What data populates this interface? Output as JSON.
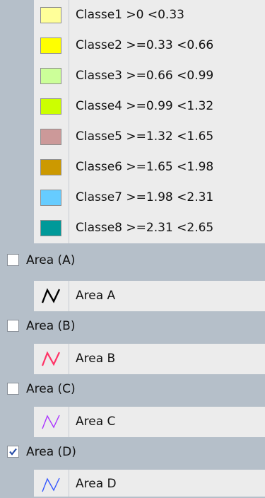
{
  "legend": {
    "classes": [
      {
        "label": "Classe1 >0 <0.33",
        "color": "#ffff99"
      },
      {
        "label": "Classe2 >=0.33 <0.66",
        "color": "#ffff00"
      },
      {
        "label": "Classe3 >=0.66 <0.99",
        "color": "#ccff99"
      },
      {
        "label": "Classe4 >=0.99 <1.32",
        "color": "#ccff00"
      },
      {
        "label": "Classe5 >=1.32 <1.65",
        "color": "#cc9999"
      },
      {
        "label": "Classe6 >=1.65 <1.98",
        "color": "#cc9900"
      },
      {
        "label": "Classe7 >=1.98 <2.31",
        "color": "#66ccff"
      },
      {
        "label": "Classe8 >=2.31 <2.65",
        "color": "#009999"
      }
    ],
    "layers": [
      {
        "title": "Area (A)",
        "checked": false,
        "symbol_label": "Area A",
        "symbol_icon": "line-symbol-icon",
        "symbol_color": "#000000"
      },
      {
        "title": "Area (B)",
        "checked": false,
        "symbol_label": "Area B",
        "symbol_icon": "line-symbol-icon",
        "symbol_color": "#ff3366"
      },
      {
        "title": "Area (C)",
        "checked": false,
        "symbol_label": "Area C",
        "symbol_icon": "line-symbol-icon",
        "symbol_color": "#aa33ff"
      },
      {
        "title": "Area (D)",
        "checked": true,
        "symbol_label": "Area D",
        "symbol_icon": "line-symbol-icon",
        "symbol_color": "#3355ff"
      }
    ]
  }
}
